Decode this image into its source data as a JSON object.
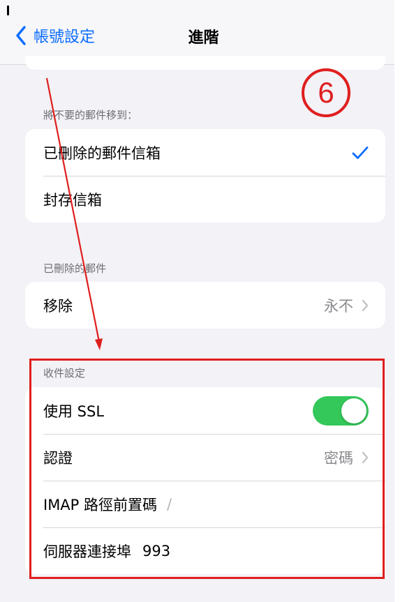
{
  "nav": {
    "back_label": "帳號設定",
    "title": "進階"
  },
  "move_section": {
    "header": "將不要的郵件移到：",
    "options": [
      {
        "label": "已刪除的郵件信箱",
        "selected": true
      },
      {
        "label": "封存信箱",
        "selected": false
      }
    ]
  },
  "deleted_section": {
    "header": "已刪除的郵件",
    "remove_label": "移除",
    "remove_value": "永不"
  },
  "incoming_section": {
    "header": "收件設定",
    "use_ssl_label": "使用 SSL",
    "use_ssl_on": true,
    "auth_label": "認證",
    "auth_value": "密碼",
    "imap_prefix_label": "IMAP 路徑前置碼",
    "imap_prefix_value": "/",
    "server_port_label": "伺服器連接埠",
    "server_port_value": "993"
  },
  "annotation": {
    "step_number": "6",
    "color": "#e01e1e"
  },
  "colors": {
    "accent": "#0a6cff",
    "toggle_on": "#34c759",
    "background": "#f2f2f7"
  }
}
